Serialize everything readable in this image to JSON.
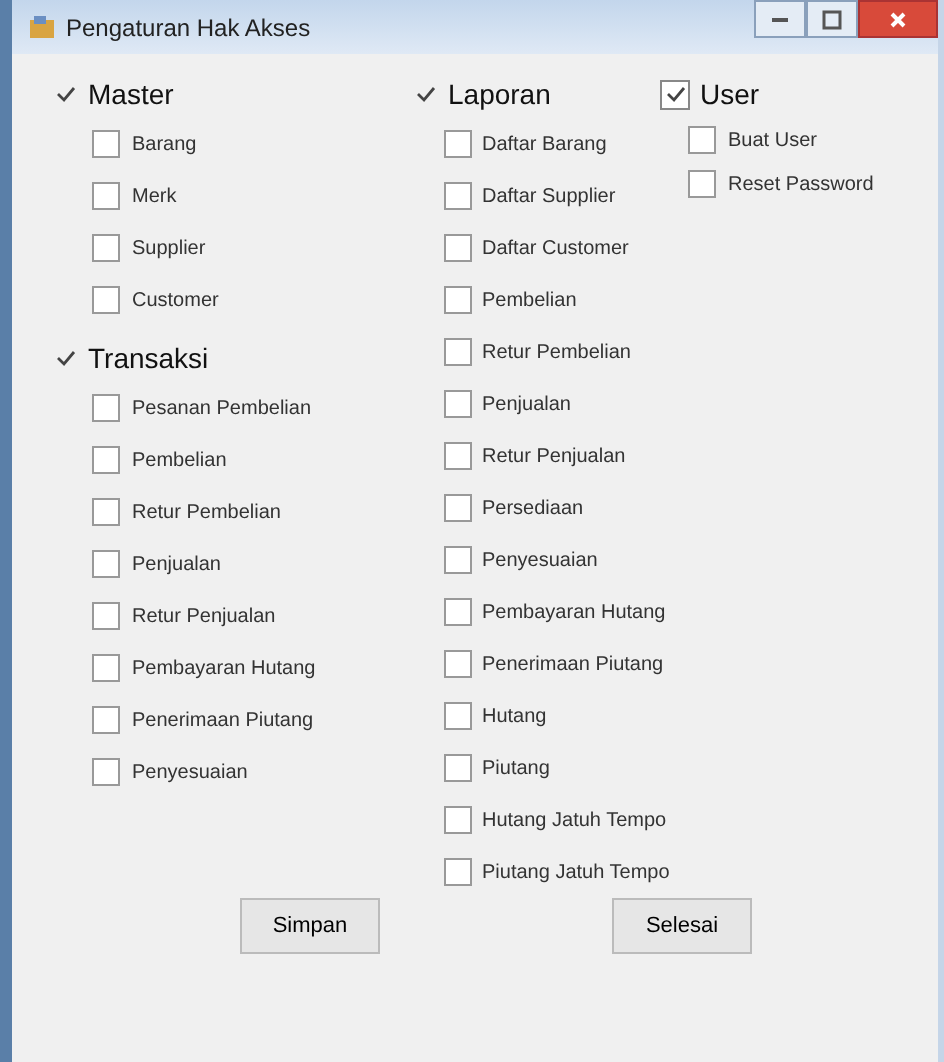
{
  "window": {
    "title": "Pengaturan Hak Akses"
  },
  "groups": [
    {
      "label": "Master",
      "checked": true,
      "items": [
        {
          "label": "Barang",
          "checked": false
        },
        {
          "label": "Merk",
          "checked": false
        },
        {
          "label": "Supplier",
          "checked": false
        },
        {
          "label": "Customer",
          "checked": false
        }
      ]
    },
    {
      "label": "Transaksi",
      "checked": true,
      "items": [
        {
          "label": "Pesanan Pembelian",
          "checked": false
        },
        {
          "label": "Pembelian",
          "checked": false
        },
        {
          "label": "Retur Pembelian",
          "checked": false
        },
        {
          "label": "Penjualan",
          "checked": false
        },
        {
          "label": "Retur Penjualan",
          "checked": false
        },
        {
          "label": "Pembayaran Hutang",
          "checked": false
        },
        {
          "label": "Penerimaan Piutang",
          "checked": false
        },
        {
          "label": "Penyesuaian",
          "checked": false
        }
      ]
    },
    {
      "label": "Laporan",
      "checked": true,
      "items": [
        {
          "label": "Daftar Barang",
          "checked": false
        },
        {
          "label": "Daftar Supplier",
          "checked": false
        },
        {
          "label": "Daftar Customer",
          "checked": false
        },
        {
          "label": "Pembelian",
          "checked": false
        },
        {
          "label": "Retur Pembelian",
          "checked": false
        },
        {
          "label": "Penjualan",
          "checked": false
        },
        {
          "label": "Retur Penjualan",
          "checked": false
        },
        {
          "label": "Persediaan",
          "checked": false
        },
        {
          "label": "Penyesuaian",
          "checked": false
        },
        {
          "label": "Pembayaran Hutang",
          "checked": false
        },
        {
          "label": "Penerimaan Piutang",
          "checked": false
        },
        {
          "label": "Hutang",
          "checked": false
        },
        {
          "label": "Piutang",
          "checked": false
        },
        {
          "label": "Hutang Jatuh Tempo",
          "checked": false
        },
        {
          "label": "Piutang Jatuh Tempo",
          "checked": false
        }
      ]
    },
    {
      "label": "User",
      "checked": true,
      "items": [
        {
          "label": "Buat User",
          "checked": false
        },
        {
          "label": "Reset Password",
          "checked": false
        }
      ]
    }
  ],
  "buttons": [
    "Simpan",
    "Selesai"
  ]
}
